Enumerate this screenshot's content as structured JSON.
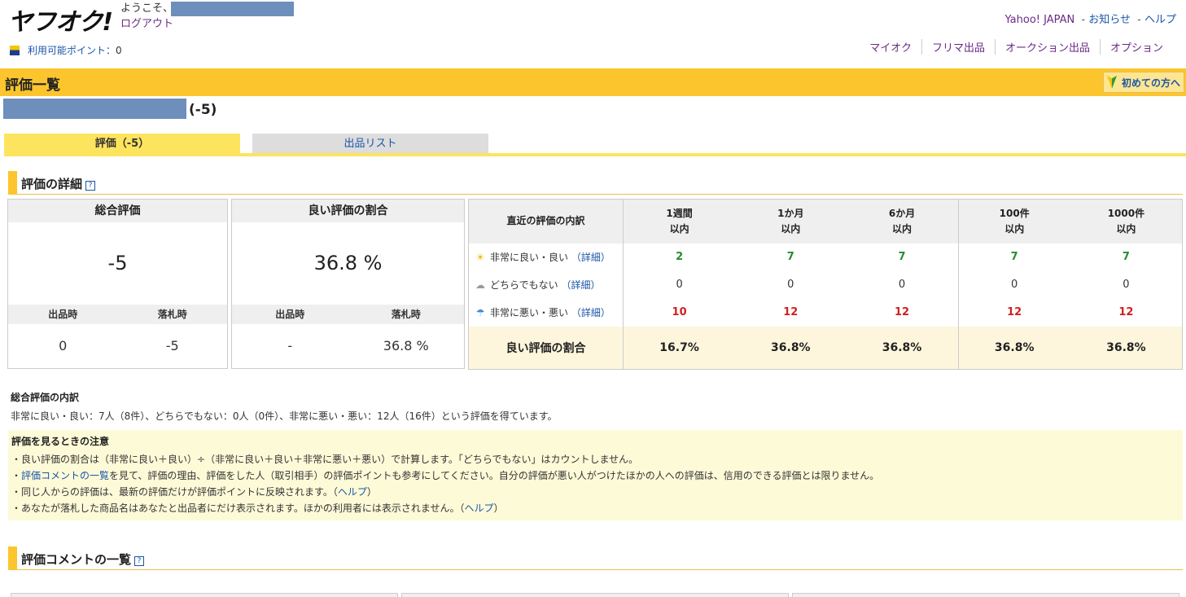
{
  "header": {
    "logo": "ヤフオク!",
    "welcome": "ようこそ、",
    "logout": "ログアウト",
    "top_links": [
      "Yahoo! JAPAN",
      "お知らせ",
      "ヘルプ"
    ],
    "separator": "-",
    "points_label": "利用可能ポイント：",
    "points_value": "0",
    "nav": [
      "マイオク",
      "フリマ出品",
      "オークション出品",
      "オプション"
    ]
  },
  "titlebar": {
    "title": "評価一覧",
    "beginner": "初めての方へ"
  },
  "user": {
    "score": "(-5)"
  },
  "tabs": [
    {
      "label": "評価（-5）"
    },
    {
      "label": "出品リスト"
    }
  ],
  "section_detail": {
    "title": "評価の詳細",
    "help": "?"
  },
  "summary": {
    "total": {
      "header": "総合評価",
      "value": "-5",
      "sub": [
        "出品時",
        "落札時"
      ],
      "vals": [
        "0",
        "-5"
      ]
    },
    "ratio": {
      "header": "良い評価の割合",
      "value": "36.8 %",
      "sub": [
        "出品時",
        "落札時"
      ],
      "vals": [
        "-",
        "36.8 %"
      ]
    }
  },
  "recent": {
    "corner": "直近の評価の内訳",
    "periods": [
      {
        "top": "1週間",
        "bottom": "以内"
      },
      {
        "top": "1か月",
        "bottom": "以内"
      },
      {
        "top": "6か月",
        "bottom": "以内"
      },
      {
        "top": "100件",
        "bottom": "以内"
      },
      {
        "top": "1000件",
        "bottom": "以内"
      }
    ],
    "rows": [
      {
        "icon": "sun-icon",
        "label": "非常に良い・良い",
        "detail": "（詳細）",
        "values": [
          "2",
          "7",
          "7",
          "7",
          "7"
        ]
      },
      {
        "icon": "cloud-icon",
        "label": "どちらでもない",
        "detail": "（詳細）",
        "values": [
          "0",
          "0",
          "0",
          "0",
          "0"
        ]
      },
      {
        "icon": "umbrella-icon",
        "label": "非常に悪い・悪い",
        "detail": "（詳細）",
        "values": [
          "10",
          "12",
          "12",
          "12",
          "12"
        ]
      }
    ],
    "ratio_label": "良い評価の割合",
    "ratio_values": [
      "16.7%",
      "36.8%",
      "36.8%",
      "36.8%",
      "36.8%"
    ]
  },
  "breakdown": {
    "title": "総合評価の内訳",
    "text": "非常に良い・良い：7人（8件）、どちらでもない：0人（0件）、非常に悪い・悪い：12人（16件）という評価を得ています。"
  },
  "notes": {
    "title": "評価を見るときの注意",
    "n1": "良い評価の割合は（非常に良い＋良い）÷（非常に良い＋良い＋非常に悪い＋悪い）で計算します。「どちらでもない」はカウントしません。",
    "n2_link": "評価コメントの一覧",
    "n2_rest": "を見て、評価の理由、評価をした人（取引相手）の評価ポイントも参考にしてください。自分の評価が悪い人がつけたほかの人への評価は、信用のできる評価とは限りません。",
    "n3": "同じ人からの評価は、最新の評価だけが評価ポイントに反映されます。（",
    "n4": "あなたが落札した商品名はあなたと出品者にだけ表示されます。ほかの利用者には表示されません。（",
    "help_link": "ヘルプ",
    "close_paren": "）"
  },
  "section_comments": {
    "title": "評価コメントの一覧",
    "help": "?"
  }
}
